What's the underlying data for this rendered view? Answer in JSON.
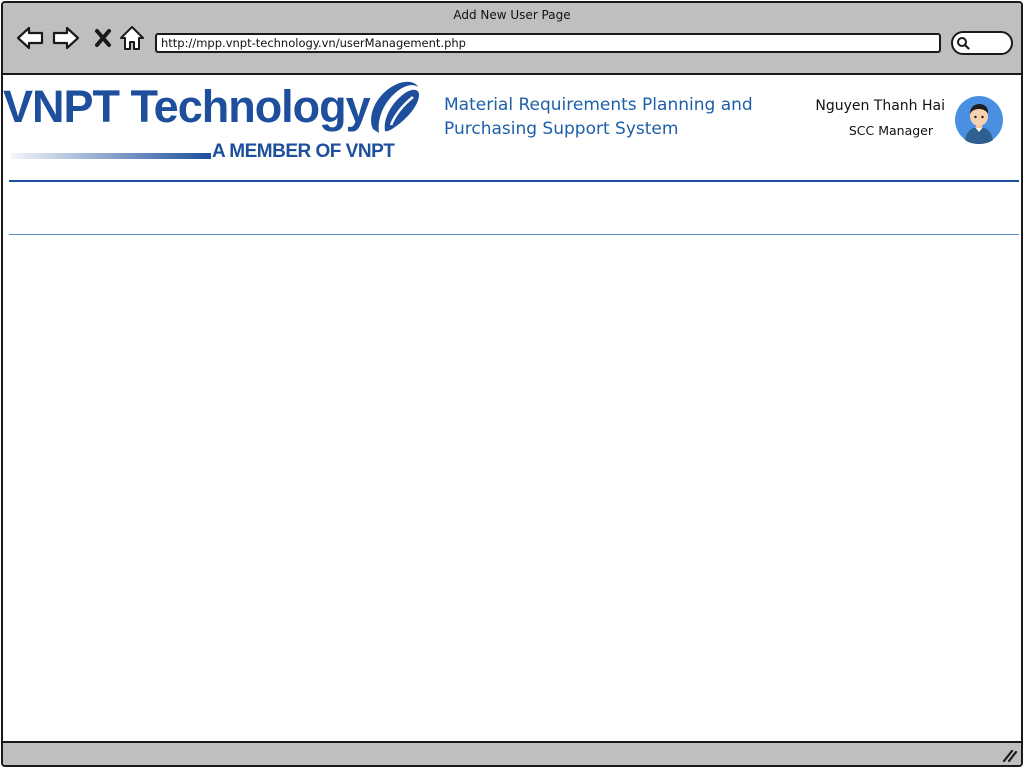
{
  "window": {
    "title": "Add New User Page"
  },
  "browser": {
    "back_icon": "arrow-left-icon",
    "forward_icon": "arrow-right-icon",
    "stop_icon": "close-icon",
    "home_icon": "home-icon",
    "url": "http://mpp.vnpt-technology.vn/userManagement.php",
    "search_icon": "search-icon"
  },
  "header": {
    "logo_text": "VNPT Technology",
    "logo_subtitle": "A MEMBER OF VNPT",
    "system_title": "Material Requirements Planning and Purchasing Support System",
    "user": {
      "name": "Nguyen Thanh Hai",
      "role": "SCC Manager",
      "avatar_icon": "user-avatar-icon"
    }
  },
  "colors": {
    "brand_blue": "#1d4f9c",
    "title_blue": "#1d5fa8",
    "chrome_gray": "#bfbfbf",
    "avatar_bg": "#4a90e2"
  }
}
